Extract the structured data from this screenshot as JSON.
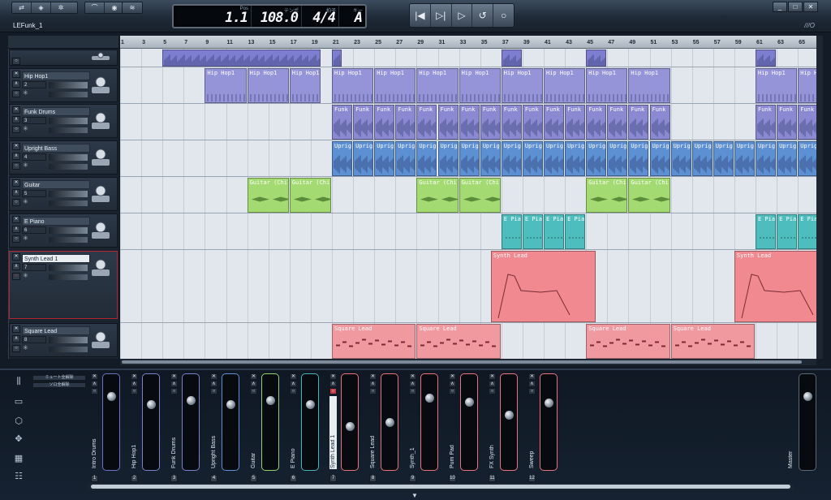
{
  "project": {
    "name": "LEFunk_1",
    "logo": "///O"
  },
  "toolbar": {
    "left_icons": [
      "link-icon",
      "cube-icon",
      "gear-icon",
      "curve-icon",
      "tuner-icon",
      "wifi-icon"
    ]
  },
  "display": {
    "pos_label": "Pos",
    "pos": "1.1",
    "tempo_label": "テンポ",
    "tempo": "108.0",
    "sig_label": "拍子",
    "sig": "4/4",
    "key_label": "キー",
    "key": "A"
  },
  "transport": [
    "|◀",
    "▷|",
    "▷",
    "↺",
    "○"
  ],
  "window": [
    "_",
    "□",
    "✕"
  ],
  "ruler_bars": [
    "1",
    "3",
    "5",
    "7",
    "9",
    "11",
    "13",
    "15",
    "17",
    "19",
    "21",
    "23",
    "25",
    "27",
    "29",
    "31",
    "33",
    "35",
    "37",
    "39",
    "41",
    "43",
    "45",
    "47",
    "49",
    "51",
    "53",
    "55",
    "57",
    "59",
    "61",
    "63",
    "65"
  ],
  "tracks": [
    {
      "name": "",
      "num": "",
      "icon": "drums-icon",
      "color": "#7777c6"
    },
    {
      "name": "Hip Hop1",
      "num": "2",
      "icon": "cymbal-icon",
      "color": "#8a89d2"
    },
    {
      "name": "Funk Drums",
      "num": "3",
      "icon": "drumkit-icon",
      "color": "#8a89d2"
    },
    {
      "name": "Upright Bass",
      "num": "4",
      "icon": "bass-icon",
      "color": "#5b8fd0"
    },
    {
      "name": "Guitar",
      "num": "5",
      "icon": "guitar-icon",
      "color": "#9ad46a"
    },
    {
      "name": "E Piano",
      "num": "6",
      "icon": "piano-icon",
      "color": "#3fb3b3"
    },
    {
      "name": "Synth Lead 1",
      "num": "7",
      "icon": "synth-icon",
      "color": "#ef7f86"
    },
    {
      "name": "Square Lead",
      "num": "8",
      "icon": "keyboard-icon",
      "color": "#ef7f86"
    }
  ],
  "clip_labels": {
    "hiphop": "Hip Hop1",
    "funk": "Funk",
    "bass": "Uprig",
    "guitar": "Guitar (Chill",
    "epiano": "E Pian",
    "synth": "Synth Lead",
    "square": "Square Lead"
  },
  "mixer": {
    "mute_labels": [
      "ミュート全解除",
      "ソロ全解除"
    ],
    "channels": [
      {
        "name": "Intro Drums",
        "num": "1",
        "color": "#6f72c4",
        "pos": 0.2
      },
      {
        "name": "Hip Hop1",
        "num": "2",
        "color": "#7d80d0",
        "pos": 0.3
      },
      {
        "name": "Funk Drums",
        "num": "3",
        "color": "#7d80d0",
        "pos": 0.25
      },
      {
        "name": "Upright Bass",
        "num": "4",
        "color": "#5d8fd1",
        "pos": 0.3
      },
      {
        "name": "Guitar",
        "num": "5",
        "color": "#8fd16b",
        "pos": 0.25
      },
      {
        "name": "E Piano",
        "num": "6",
        "color": "#46b7b7",
        "pos": 0.3
      },
      {
        "name": "Synth Lead 1",
        "num": "7",
        "color": "#e9737c",
        "pos": 0.55
      },
      {
        "name": "Square Lead",
        "num": "8",
        "color": "#e9737c",
        "pos": 0.5
      },
      {
        "name": "Synth_1",
        "num": "9",
        "color": "#e9737c",
        "pos": 0.22
      },
      {
        "name": "Pum Pad",
        "num": "10",
        "color": "#e9737c",
        "pos": 0.27
      },
      {
        "name": "FX Synth",
        "num": "11",
        "color": "#e9737c",
        "pos": 0.42
      },
      {
        "name": "Sweep",
        "num": "12",
        "color": "#e9737c",
        "pos": 0.28
      }
    ],
    "master": {
      "name": "Master",
      "pos": 0.2
    }
  }
}
